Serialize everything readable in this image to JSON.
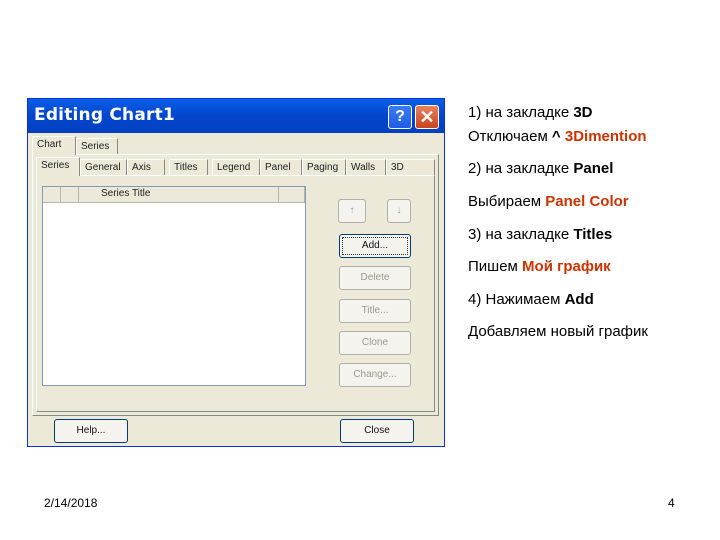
{
  "dialog": {
    "title": "Editing Chart1",
    "help_glyph": "?",
    "close_glyph": "✕",
    "top_tabs": [
      "Chart",
      "Series"
    ],
    "sub_tabs": [
      "Series",
      "General",
      "Axis",
      "Titles",
      "Legend",
      "Panel",
      "Paging",
      "Walls",
      "3D"
    ],
    "list_header": "Series Title",
    "side_buttons": {
      "up": "↑",
      "down": "↓",
      "add": "Add...",
      "delete": "Delete",
      "title": "Title...",
      "clone": "Clone",
      "change": "Change..."
    },
    "bottom_buttons": {
      "help": "Help...",
      "close": "Close"
    }
  },
  "notes": [
    {
      "prefix": "1) на закладке ",
      "bold": "3D",
      "suffix": ""
    },
    {
      "prefix": "Отключаем ",
      "bold": "^ ",
      "highlight": "3Dimention"
    },
    {
      "prefix": "2) на закладке ",
      "bold": "Panel",
      "suffix": ""
    },
    {
      "prefix": "Выбираем ",
      "highlight": "Panel Color"
    },
    {
      "prefix": "3) на закладке ",
      "bold": "Titles",
      "suffix": ""
    },
    {
      "prefix": "Пишем ",
      "highlight": "Мой график"
    },
    {
      "prefix": "4) Нажимаем ",
      "bold": "Add",
      "suffix": ""
    },
    {
      "prefix": "Добавляем новый график"
    }
  ],
  "footer": {
    "date": "2/14/2018",
    "page": "4"
  },
  "colors": {
    "highlight": "#cc3300",
    "titlebar": "#0347cf"
  }
}
